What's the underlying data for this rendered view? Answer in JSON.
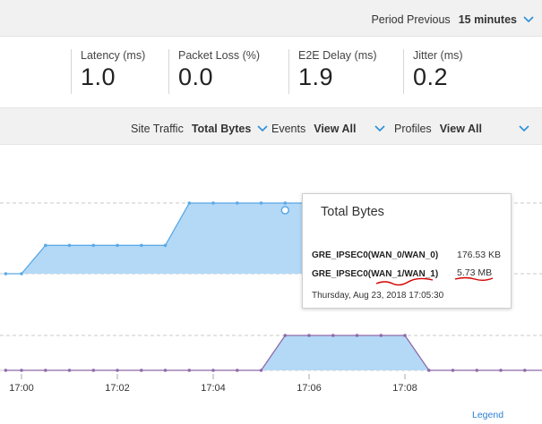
{
  "header": {
    "period_label": "Period Previous",
    "period_value": "15 minutes"
  },
  "metrics": [
    {
      "label": "Latency (ms)",
      "value": "1.0"
    },
    {
      "label": "Packet Loss (%)",
      "value": "0.0"
    },
    {
      "label": "E2E Delay (ms)",
      "value": "1.9"
    },
    {
      "label": "Jitter (ms)",
      "value": "0.2"
    }
  ],
  "filters": {
    "site_traffic_label": "Site Traffic",
    "site_traffic_value": "Total Bytes",
    "events_label": "Events",
    "events_value": "View All",
    "profiles_label": "Profiles",
    "profiles_value": "View All"
  },
  "colors": {
    "area_fill": "#b3d9f7",
    "series1_line": "#5aa9e6",
    "series2_line": "#8e6aa8",
    "accent": "#2b8fd8",
    "annotation": "#d40000"
  },
  "tooltip": {
    "title": "Total Bytes",
    "rows": [
      {
        "name": "GRE_IPSEC0(WAN_0/WAN_0)",
        "value": "176.53 KB"
      },
      {
        "name": "GRE_IPSEC0(WAN_1/WAN_1)",
        "value": "5.73 MB"
      }
    ],
    "timestamp": "Thursday, Aug 23, 2018 17:05:30"
  },
  "legend_link": "Legend",
  "chart_data": {
    "type": "area",
    "x_ticks": [
      "17:00",
      "17:02",
      "17:04",
      "17:06",
      "17:08"
    ],
    "series": [
      {
        "name": "GRE_IPSEC0(WAN_1/WAN_1)",
        "x": [
          16.67,
          17.0,
          17.5,
          18.0,
          18.5,
          19.0,
          19.5,
          20.0,
          20.5,
          21.0,
          21.5,
          22.0,
          22.5,
          23.0,
          23.5,
          24.0,
          24.5,
          25.5
        ],
        "y": [
          0.0,
          0.0,
          2.3,
          2.3,
          2.3,
          2.3,
          2.3,
          2.3,
          5.73,
          5.73,
          5.73,
          5.73,
          5.73,
          5.73,
          5.73,
          5.73,
          5.73,
          0.0
        ]
      },
      {
        "name": "GRE_IPSEC0(WAN_0/WAN_0)",
        "x": [
          16.67,
          17.0,
          17.5,
          18.0,
          18.5,
          19.0,
          19.5,
          20.0,
          20.5,
          21.0,
          21.5,
          22.0,
          22.5,
          23.0,
          23.5,
          24.0,
          24.5,
          25.0,
          25.5,
          26.0,
          26.5,
          27.0,
          27.5,
          28.0,
          28.5,
          29.0,
          29.5
        ],
        "y": [
          0.0,
          0.0,
          0.0,
          0.0,
          0.0,
          0.0,
          0.0,
          0.0,
          0.0,
          0.0,
          0.0,
          0.0,
          1.0,
          1.0,
          1.0,
          1.0,
          1.0,
          1.0,
          0.0,
          0.0,
          0.0,
          0.0,
          0.0,
          0.0,
          0.0,
          0.0,
          0.0
        ]
      }
    ],
    "grid": true
  }
}
